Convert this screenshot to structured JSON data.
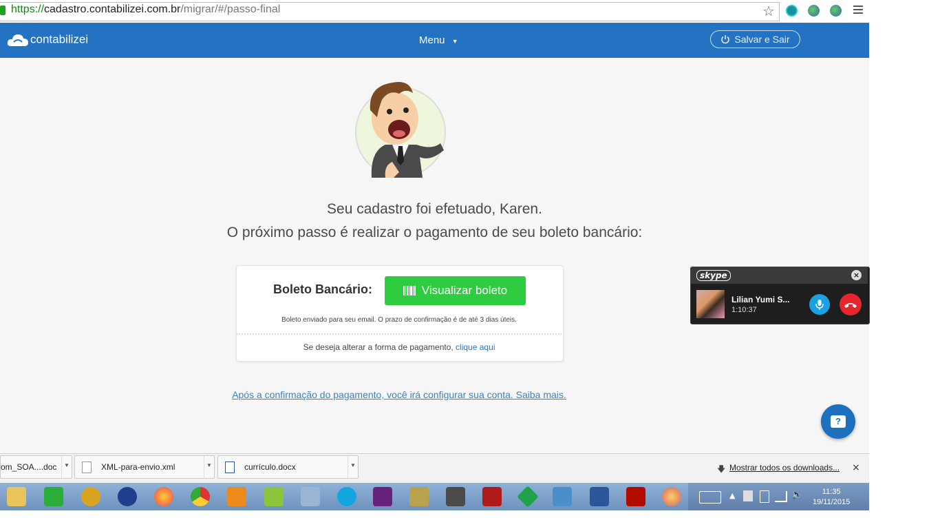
{
  "browser": {
    "url_scheme": "https://",
    "url_host": "cadastro.contabilizei.com.br",
    "url_path": "/migrar/#/passo-final"
  },
  "navbar": {
    "brand": "contabilizei",
    "menu_label": "Menu",
    "save_exit_label": "Salvar e Sair",
    "background_color": "#2373c2"
  },
  "main": {
    "line1": "Seu cadastro foi efetuado, Karen.",
    "line2": "O próximo passo é realizar o pagamento de seu boleto bancário:",
    "boleto_label": "Boleto Bancário:",
    "boleto_button": "Visualizar boleto",
    "boleto_note": "Boleto enviado para seu email. O prazo de confirmação é de até 3 dias úteis.",
    "change_text": "Se deseja alterar a forma de pagamento, ",
    "change_link": "clique aqui",
    "after_link": "Após a confirmação do pagamento, você irá configurar sua conta. Saiba mais.",
    "help_icon": "?"
  },
  "skype": {
    "logo": "skype",
    "contact_name": "Lilian Yumi S...",
    "call_time": "1:10:37"
  },
  "downloads": {
    "items": [
      {
        "name": "om_SOA....doc"
      },
      {
        "name": "XML-para-envio.xml"
      },
      {
        "name": "currículo.docx"
      }
    ],
    "show_all": "Mostrar todos os downloads..."
  },
  "taskbar": {
    "time": "11:35",
    "date": "19/11/2015"
  }
}
